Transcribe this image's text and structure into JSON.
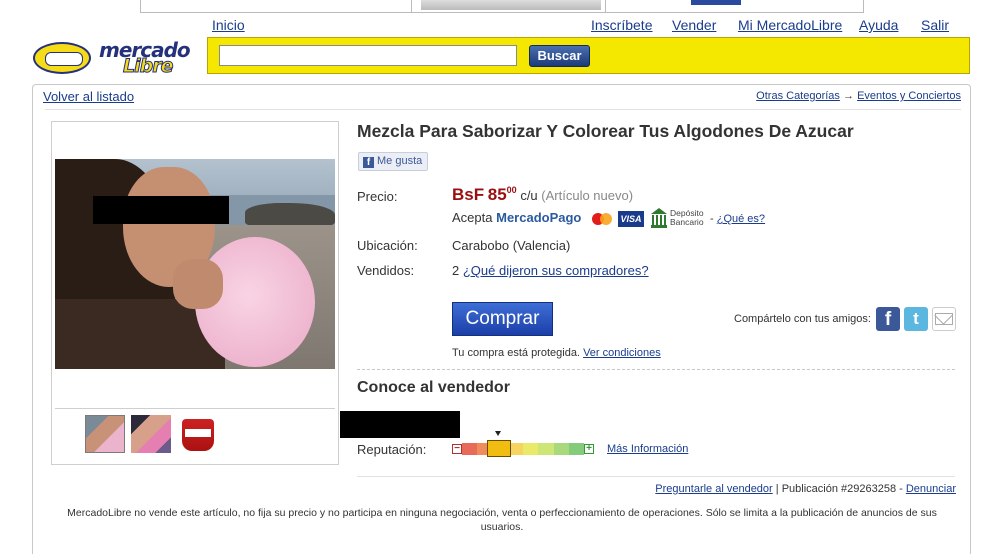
{
  "nav": {
    "home": "Inicio",
    "items": [
      "Inscríbete",
      "Vender",
      "Mi MercadoLibre",
      "Ayuda",
      "Salir"
    ]
  },
  "logo": {
    "line1": "mercado",
    "line2": "Libre"
  },
  "search": {
    "placeholder": "",
    "button": "Buscar"
  },
  "back_link": "Volver al listado",
  "breadcrumb": {
    "first": "Otras Categorías",
    "separator": "→",
    "second": "Eventos y Conciertos"
  },
  "product": {
    "title": "Mezcla Para Saborizar Y Colorear Tus Algodones De Azucar",
    "like": "Me gusta",
    "price_label": "Precio:",
    "currency": "BsF",
    "price_int": "85",
    "price_cents": "00",
    "price_unit": "c/u",
    "condition": "(Artículo nuevo)",
    "accept_prefix": "Acepta",
    "accept_brand": "MercadoPago",
    "bank_line1": "Depósito",
    "bank_line2": "Bancario",
    "que_es_prefix": "-",
    "que_es": "¿Qué es?",
    "location_label": "Ubicación:",
    "location": "Carabobo (Valencia)",
    "sold_label": "Vendidos:",
    "sold_count": "2",
    "sold_link": "¿Qué dijeron sus compradores?",
    "buy": "Comprar",
    "protected_text": "Tu compra está protegida.",
    "protected_link": "Ver condiciones",
    "share_label": "Compártelo con tus amigos:"
  },
  "seller": {
    "heading": "Conoce al vendedor",
    "reputation_label": "Reputación:",
    "reputation_level": 0.3,
    "more_info": "Más Información"
  },
  "footer": {
    "ask": "Preguntarle al vendedor",
    "publication": "| Publicación #29263258 -",
    "report": "Denunciar",
    "disclaimer": "MercadoLibre no vende este artículo, no fija su precio y no participa en ninguna negociación, venta o perfeccionamiento de operaciones. Sólo se limita a la publicación de anuncios de sus usuarios."
  },
  "colors": {
    "brand_yellow": "#f5e800",
    "brand_blue": "#26317c",
    "price_red": "#9a0f0f",
    "link_blue": "#1a3c8c",
    "reputation": [
      "#e86b5a",
      "#f08c5c",
      "#f5b35c",
      "#f7d45f",
      "#eaea6a",
      "#cde675",
      "#a8d97a",
      "#84cc7c"
    ]
  }
}
